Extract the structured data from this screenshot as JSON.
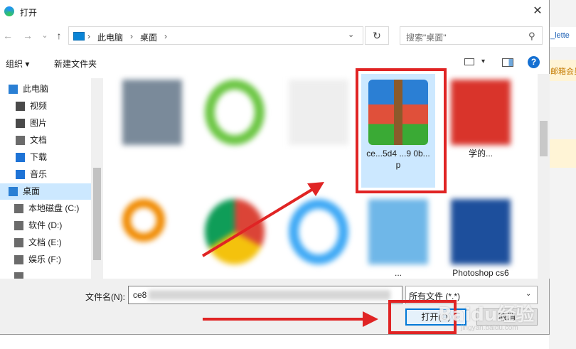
{
  "window": {
    "title": "打开",
    "close_glyph": "✕"
  },
  "backdrop": {
    "text1": "_lette",
    "text2": "邮箱会员"
  },
  "nav": {
    "back_glyph": "←",
    "forward_glyph": "→",
    "recent_glyph": "⌄",
    "up_glyph": "↑",
    "breadcrumb": [
      "此电脑",
      "桌面"
    ],
    "separator": "›",
    "dropdown_glyph": "⌄",
    "refresh_glyph": "↻",
    "search_placeholder": "搜索\"桌面\"",
    "search_glyph": "⚲"
  },
  "toolbar": {
    "organize": "组织",
    "organize_drop": "▾",
    "new_folder": "新建文件夹",
    "view_drop": "▾",
    "help": "?"
  },
  "sidebar": {
    "items": [
      {
        "label": "此电脑",
        "icon": "pc-icon",
        "color": "#2a7fd4",
        "selected": false
      },
      {
        "label": "视频",
        "icon": "video-icon",
        "color": "#4a4a4a",
        "selected": false
      },
      {
        "label": "图片",
        "icon": "picture-icon",
        "color": "#4a4a4a",
        "selected": false
      },
      {
        "label": "文档",
        "icon": "document-icon",
        "color": "#6b6b6b",
        "selected": false
      },
      {
        "label": "下载",
        "icon": "download-icon",
        "color": "#1e73d6",
        "selected": false
      },
      {
        "label": "音乐",
        "icon": "music-icon",
        "color": "#1e73d6",
        "selected": false
      },
      {
        "label": "桌面",
        "icon": "desktop-icon",
        "color": "#2a7fd4",
        "selected": true
      },
      {
        "label": "本地磁盘 (C:)",
        "icon": "drive-c-icon",
        "color": "#6b6b6b",
        "selected": false
      },
      {
        "label": "软件 (D:)",
        "icon": "drive-icon",
        "color": "#6b6b6b",
        "selected": false
      },
      {
        "label": "文档 (E:)",
        "icon": "drive-icon",
        "color": "#6b6b6b",
        "selected": false
      },
      {
        "label": "娱乐 (F:)",
        "icon": "drive-icon",
        "color": "#6b6b6b",
        "selected": false
      },
      {
        "label": "",
        "icon": "drive-icon",
        "color": "#6b6b6b",
        "selected": false
      }
    ]
  },
  "files": [
    {
      "name": "",
      "icon": "photo-thumbnail",
      "color": "#7a8a9a"
    },
    {
      "name": "",
      "icon": "ie-green-icon",
      "color": "#6cc644"
    },
    {
      "name": "",
      "icon": "blank-document-icon",
      "color": "#eeeeee"
    },
    {
      "name": "ce...5d4 ...9 0b...p",
      "icon": "winrar-archive-icon",
      "color": "#2b7fd4"
    },
    {
      "name": "学的...",
      "icon": "pdf-icon",
      "color": "#d9342b"
    },
    {
      "name": "",
      "icon": "magnifier-app-icon",
      "color": "#f08a00"
    },
    {
      "name": "",
      "icon": "chrome-icon",
      "color": "#db4437"
    },
    {
      "name": "",
      "icon": "internet-explorer-icon",
      "color": "#3fa9f5"
    },
    {
      "name": "...",
      "icon": "image-file-icon",
      "color": "#6fb7e8"
    },
    {
      "name": "Photoshop cs6",
      "icon": "photoshop-icon",
      "color": "#1d4f9c"
    }
  ],
  "bottom": {
    "filename_label": "文件名(N):",
    "filename_value": "ce8",
    "filter_value": "所有文件 (*.*)",
    "filter_drop": "⌄",
    "open_button": "打开(O)",
    "cancel_button": "取消"
  },
  "annotations": {
    "watermark": "Baidu经验",
    "watermark_sub": "jingyan.baidu.com",
    "highlight_color": "#e02424"
  }
}
